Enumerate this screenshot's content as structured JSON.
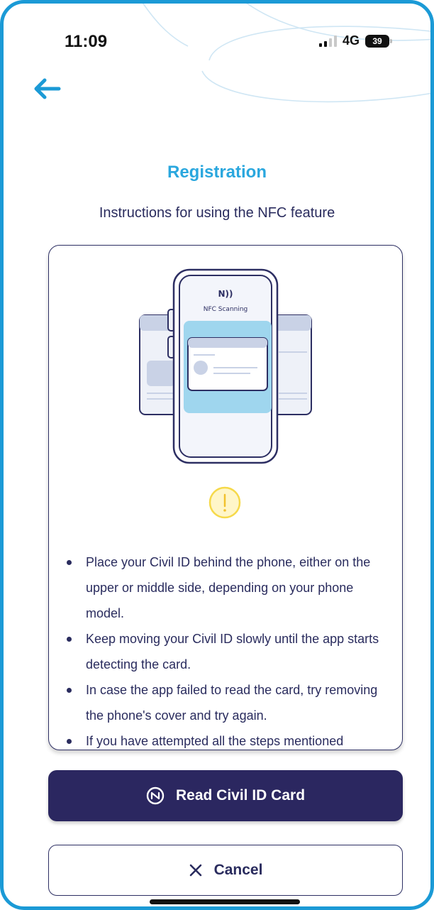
{
  "status_bar": {
    "time": "11:09",
    "network": "4G",
    "battery": "39"
  },
  "header": {
    "back_icon": "arrow-left-icon",
    "title": "Registration",
    "subtitle": "Instructions for using the NFC feature"
  },
  "illustration": {
    "nfc_symbol": "N))",
    "label": "NFC Scanning"
  },
  "instructions": [
    "Place your Civil ID behind the phone, either on the upper or middle side, depending on your phone model.",
    "Keep moving your Civil ID slowly until the app starts detecting the card.",
    "In case the app failed to read the card, try removing the phone's cover and try again.",
    "If you have attempted all the steps mentioned"
  ],
  "actions": {
    "read_label": "Read Civil ID Card",
    "read_icon": "nfc-icon",
    "cancel_label": "Cancel",
    "cancel_icon": "close-icon"
  },
  "colors": {
    "accent": "#2aa7de",
    "primary": "#2b2760",
    "text": "#2a2c5e",
    "warning": "#f6d94a"
  }
}
